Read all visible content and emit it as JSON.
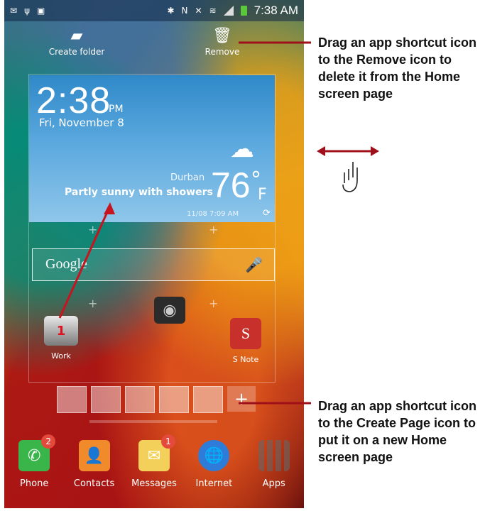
{
  "status_bar": {
    "time": "7:38 AM"
  },
  "top_actions": [
    {
      "label": "Create folder",
      "icon": "folder-plus-icon"
    },
    {
      "label": "Remove",
      "icon": "trash-icon"
    }
  ],
  "weather": {
    "time": "2:38",
    "ampm": "PM",
    "date": "Fri, November 8",
    "city": "Durban",
    "condition": "Partly sunny with showers",
    "temperature": "76",
    "unit": "F",
    "updated": "11/08 7:09 AM"
  },
  "google": {
    "logo": "Google"
  },
  "apps": [
    {
      "label": "Work",
      "badge": "1"
    },
    {
      "label": "",
      "icon": "camera-icon"
    },
    {
      "label": "S Note"
    }
  ],
  "dock": [
    {
      "label": "Phone",
      "badge": "2"
    },
    {
      "label": "Contacts"
    },
    {
      "label": "Messages",
      "badge": "1"
    },
    {
      "label": "Internet"
    },
    {
      "label": "Apps"
    }
  ],
  "annotations": {
    "top": "Drag an app shortcut icon to the Remove icon to delete it from the Home screen page",
    "bottom": "Drag an app shortcut icon to the Create Page icon to put it on a new Home screen page"
  },
  "colors": {
    "callout_line": "#a0101a",
    "annotation_text": "#111111"
  }
}
